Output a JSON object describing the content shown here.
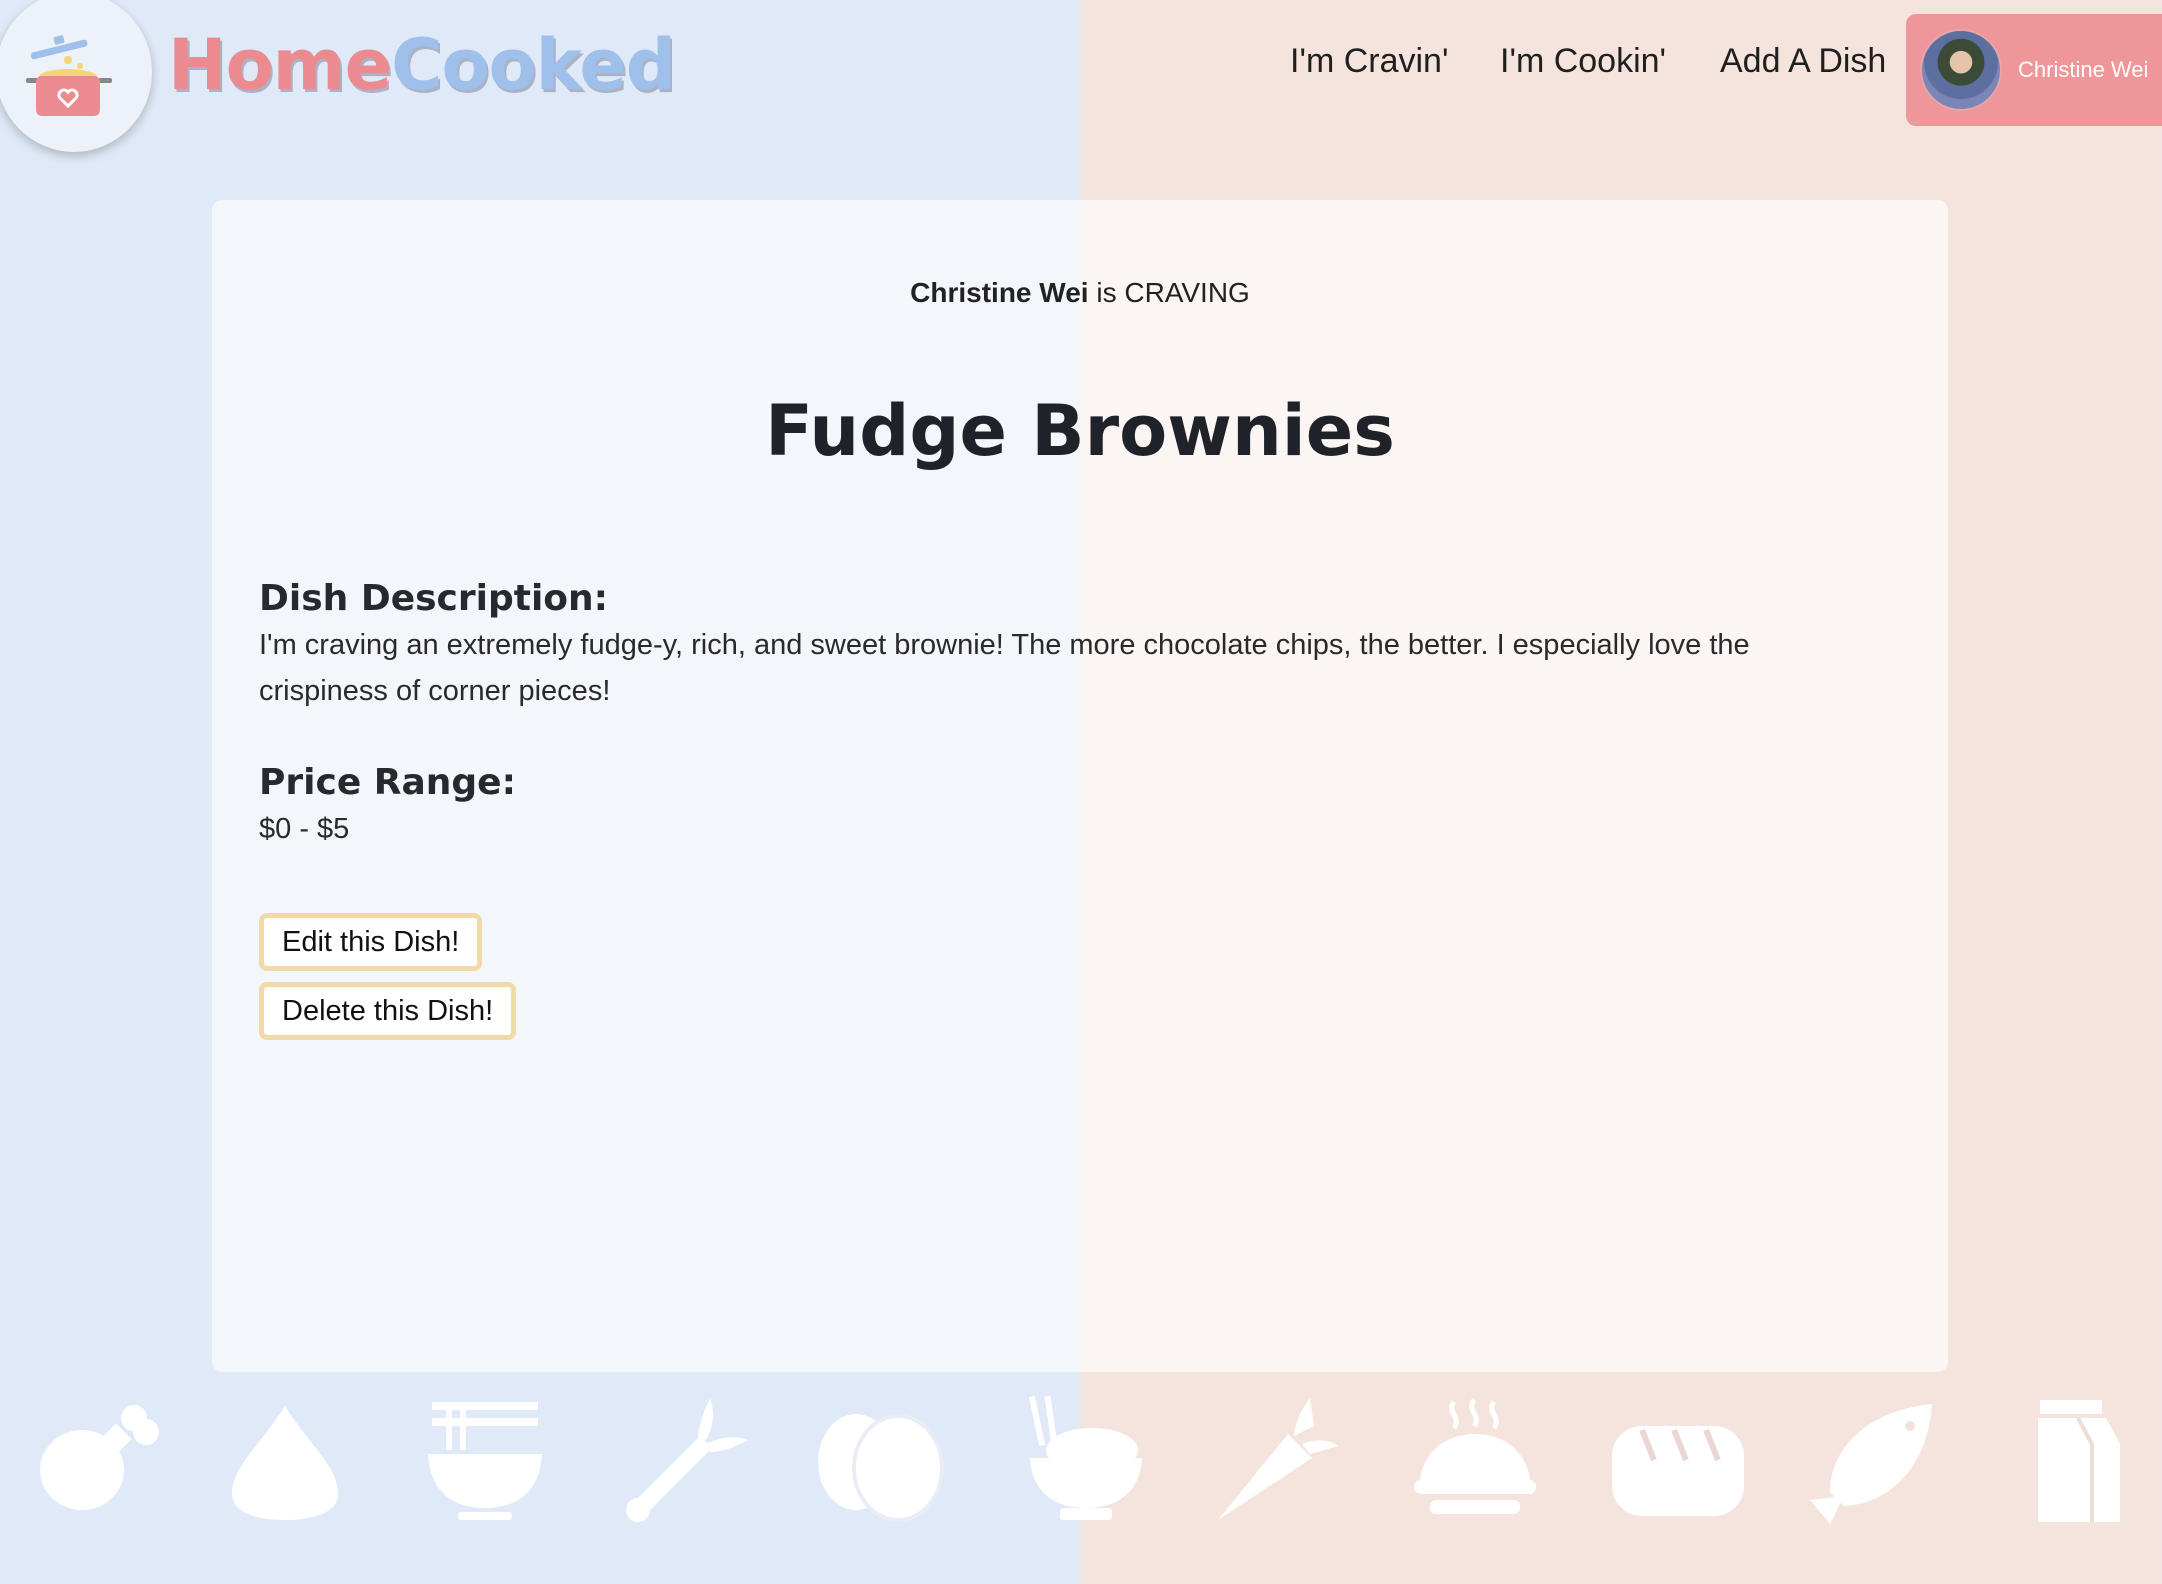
{
  "header": {
    "brand_part1": "Home",
    "brand_part2": "Cooked",
    "logo_icon": "cooking-pot-heart",
    "nav": [
      "I'm Cravin'",
      "I'm Cookin'",
      "Add A Dish"
    ],
    "user_name": "Christine Wei"
  },
  "dish": {
    "author": "Christine Wei",
    "status_text": "is CRAVING",
    "title": "Fudge Brownies",
    "description_label": "Dish Description:",
    "description": "I'm craving an extremely fudge-y, rich, and sweet brownie! The more chocolate chips, the better. I especially love the crispiness of corner pieces!",
    "price_label": "Price Range:",
    "price": "$0 - $5",
    "edit_button": "Edit this Dish!",
    "delete_button": "Delete this Dish!"
  },
  "footer_icons": [
    "drumstick-icon",
    "garlic-icon",
    "noodle-bowl-icon",
    "leek-icon",
    "eggs-icon",
    "rice-bowl-icon",
    "carrot-icon",
    "pie-icon",
    "bread-icon",
    "fish-icon",
    "milk-carton-icon"
  ],
  "colors": {
    "bg_left": "#dfe9f7",
    "bg_right": "#f5e3dd",
    "brand_pink": "#ec8b8f",
    "brand_blue": "#9ec0ea",
    "user_pill": "#ef969a",
    "button_border": "#f2d9a8"
  }
}
